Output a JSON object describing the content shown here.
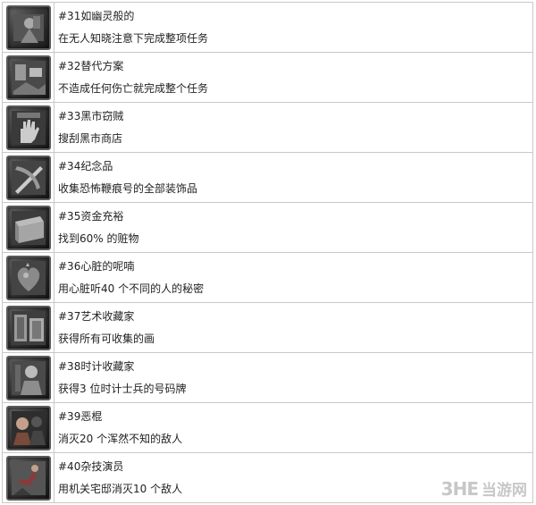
{
  "achievements": [
    {
      "title": "#31如幽灵般的",
      "description": "在无人知晓注意下完成整项任务",
      "icon": "ghost-figure-icon"
    },
    {
      "title": "#32替代方案",
      "description": "不造成任何伤亡就完成整个任务",
      "icon": "scene-alternative-icon"
    },
    {
      "title": "#33黑市窃贼",
      "description": "搜刮黑市商店",
      "icon": "hand-icon"
    },
    {
      "title": "#34纪念品",
      "description": "收集恐怖鞭痕号的全部装饰品",
      "icon": "crossed-blades-icon"
    },
    {
      "title": "#35资金充裕",
      "description": "找到60% 的赃物",
      "icon": "chest-icon"
    },
    {
      "title": "#36心脏的呢喃",
      "description": "用心脏听40 个不同的人的秘密",
      "icon": "heart-icon"
    },
    {
      "title": "#37艺术收藏家",
      "description": "获得所有可收集的画",
      "icon": "paintings-icon"
    },
    {
      "title": "#38时计收藏家",
      "description": "获得3 位时计士兵的号码牌",
      "icon": "clock-soldier-icon"
    },
    {
      "title": "#39恶棍",
      "description": "消灭20 个浑然不知的敌人",
      "icon": "villain-icon"
    },
    {
      "title": "#40杂技演员",
      "description": "用机关宅邸消灭10 个敌人",
      "icon": "acrobat-icon"
    }
  ],
  "watermark": {
    "logo": "3HE",
    "text": "当游网"
  }
}
